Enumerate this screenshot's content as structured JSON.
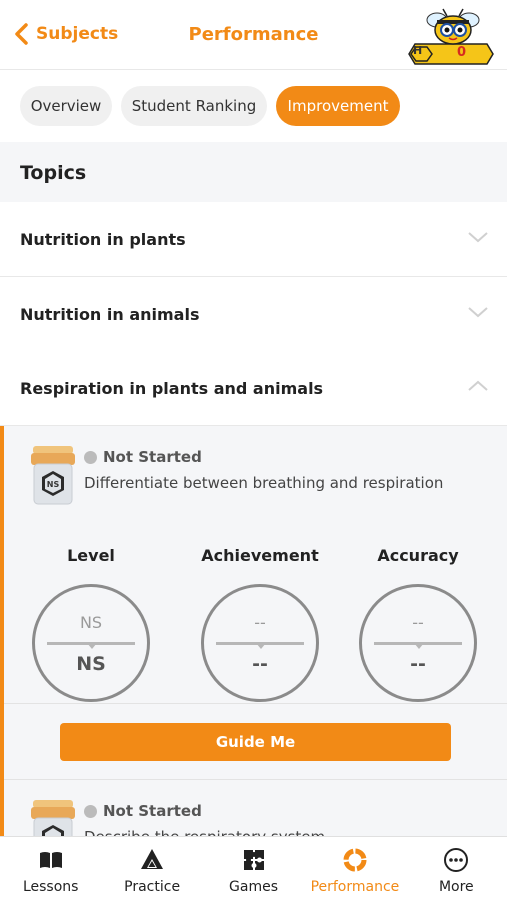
{
  "header": {
    "back_label": "Subjects",
    "title": "Performance",
    "hive_badge": "H",
    "hive_count": "0"
  },
  "tabs": [
    {
      "label": "Overview",
      "active": false
    },
    {
      "label": "Student Ranking",
      "active": false
    },
    {
      "label": "Improvement",
      "active": true
    }
  ],
  "topics": {
    "heading": "Topics",
    "items": [
      {
        "label": "Nutrition in plants",
        "expanded": false
      },
      {
        "label": "Nutrition in animals",
        "expanded": false
      },
      {
        "label": "Respiration in plants and animals",
        "expanded": true
      }
    ]
  },
  "skills": [
    {
      "status": "Not Started",
      "description": "Differentiate between breathing and respiration",
      "jar_badge": "NS",
      "metrics": [
        {
          "label": "Level",
          "top": "NS",
          "bottom": "NS"
        },
        {
          "label": "Achievement",
          "top": "--",
          "bottom": "--"
        },
        {
          "label": "Accuracy",
          "top": "--",
          "bottom": "--"
        }
      ],
      "button": "Guide Me"
    },
    {
      "status": "Not Started",
      "description": "Describe the respiratory system"
    }
  ],
  "nav": [
    {
      "label": "Lessons",
      "icon": "book-icon",
      "active": false
    },
    {
      "label": "Practice",
      "icon": "triangles-icon",
      "active": false
    },
    {
      "label": "Games",
      "icon": "puzzle-icon",
      "active": false
    },
    {
      "label": "Performance",
      "icon": "performance-icon",
      "active": true
    },
    {
      "label": "More",
      "icon": "more-icon",
      "active": false
    }
  ],
  "colors": {
    "accent": "#f28a16",
    "count": "#d62b1f",
    "panel": "#f5f6f8"
  }
}
